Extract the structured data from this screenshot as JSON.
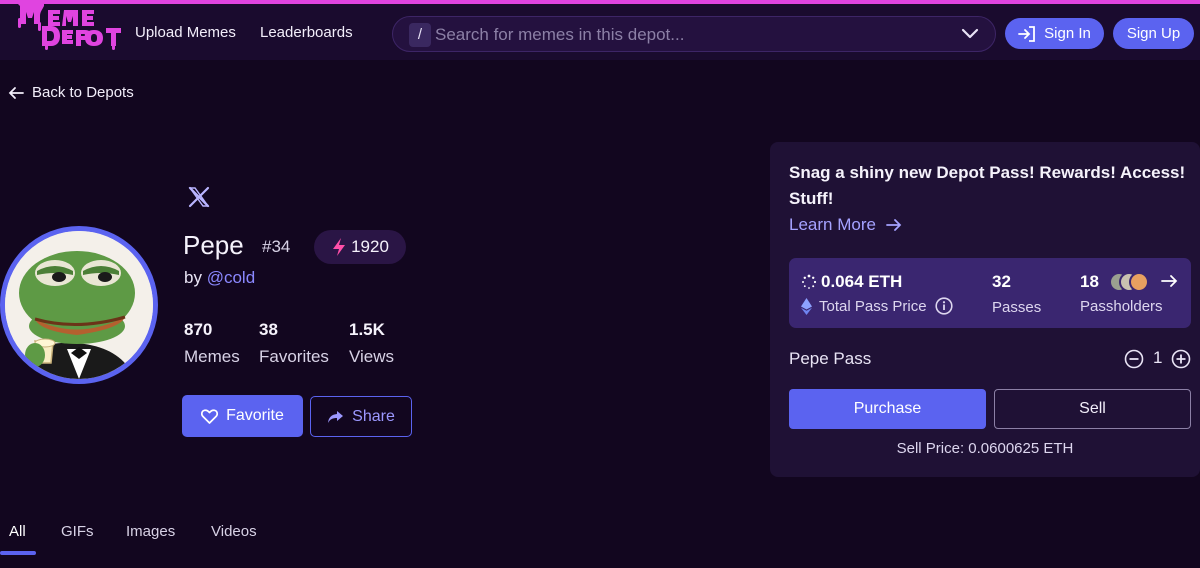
{
  "header": {
    "logo_text": "Meme Depot",
    "nav": [
      "Upload Memes",
      "Leaderboards"
    ],
    "search": {
      "shortcut": "/",
      "placeholder": "Search for memes in this depot..."
    },
    "sign_in": "Sign In",
    "sign_up": "Sign Up",
    "accent": "#e044e0"
  },
  "back_link": "Back to Depots",
  "profile": {
    "name": "Pepe",
    "rank": "#34",
    "score": "1920",
    "by_prefix": "by",
    "handle": "@cold",
    "stats": [
      {
        "value": "870",
        "label": "Memes"
      },
      {
        "value": "38",
        "label": "Favorites"
      },
      {
        "value": "1.5K",
        "label": "Views"
      }
    ],
    "favorite_label": "Favorite",
    "share_label": "Share"
  },
  "pass_panel": {
    "promo": "Snag a shiny new Depot Pass! Rewards! Access! Stuff!",
    "learn_more": "Learn More",
    "price": "0.064 ETH",
    "price_label": "Total Pass Price",
    "passes_value": "32",
    "passes_label": "Passes",
    "holders_value": "18",
    "holders_label": "Passholders",
    "pass_name": "Pepe Pass",
    "quantity": "1",
    "purchase_label": "Purchase",
    "sell_label": "Sell",
    "sell_price": "Sell Price: 0.0600625 ETH"
  },
  "tabs": [
    "All",
    "GIFs",
    "Images",
    "Videos"
  ],
  "colors": {
    "primary": "#5b63f0",
    "background": "#12061f",
    "panel": "#1f1135"
  }
}
